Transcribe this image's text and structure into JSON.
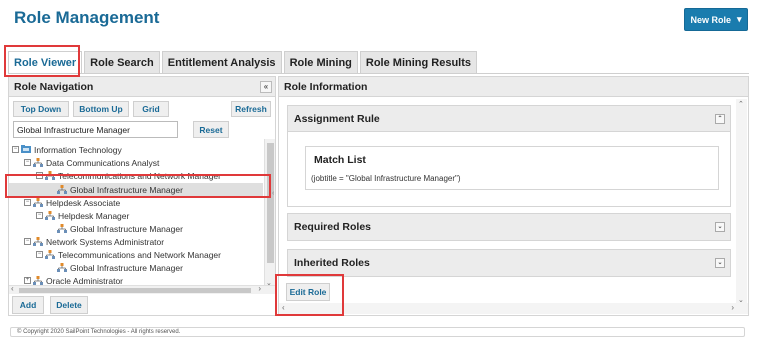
{
  "page": {
    "title": "Role Management"
  },
  "header": {
    "new_role_label": "New Role",
    "caret": "▾"
  },
  "tabs": [
    {
      "label": "Role Viewer",
      "active": true
    },
    {
      "label": "Role Search",
      "active": false
    },
    {
      "label": "Entitlement Analysis",
      "active": false
    },
    {
      "label": "Role Mining",
      "active": false
    },
    {
      "label": "Role Mining Results",
      "active": false
    }
  ],
  "role_navigation": {
    "title": "Role Navigation",
    "collapse_glyph": "«",
    "buttons": {
      "top_down": "Top Down",
      "bottom_up": "Bottom Up",
      "grid": "Grid",
      "refresh": "Refresh"
    },
    "search_value": "Global Infrastructure Manager",
    "reset_label": "Reset",
    "tree": [
      {
        "label": "Information Technology",
        "kind": "folder"
      },
      {
        "label": "Data Communications Analyst",
        "kind": "role"
      },
      {
        "label": "Telecommunications and Network Manager",
        "kind": "role"
      },
      {
        "label": "Global Infrastructure Manager",
        "kind": "leaf",
        "selected": true
      },
      {
        "label": "Helpdesk Associate",
        "kind": "role"
      },
      {
        "label": "Helpdesk Manager",
        "kind": "role"
      },
      {
        "label": "Global Infrastructure Manager",
        "kind": "leaf"
      },
      {
        "label": "Network Systems Administrator",
        "kind": "role"
      },
      {
        "label": "Telecommunications and Network Manager",
        "kind": "role"
      },
      {
        "label": "Global Infrastructure Manager",
        "kind": "leaf"
      },
      {
        "label": "Oracle Administrator",
        "kind": "role"
      }
    ],
    "add_label": "Add",
    "delete_label": "Delete"
  },
  "role_information": {
    "title": "Role Information",
    "assignment_rule": {
      "title": "Assignment Rule",
      "match_list_title": "Match List",
      "rule": "(jobtitle = \"Global Infrastructure Manager\")"
    },
    "required_roles_title": "Required Roles",
    "inherited_roles_title": "Inherited Roles",
    "edit_role_label": "Edit Role"
  },
  "footer": {
    "copyright": "© Copyright 2020 SailPoint Technologies - All rights reserved."
  },
  "colors": {
    "brand": "#1a6a96",
    "button_primary": "#1a7cae",
    "highlight": "#e0393a"
  }
}
